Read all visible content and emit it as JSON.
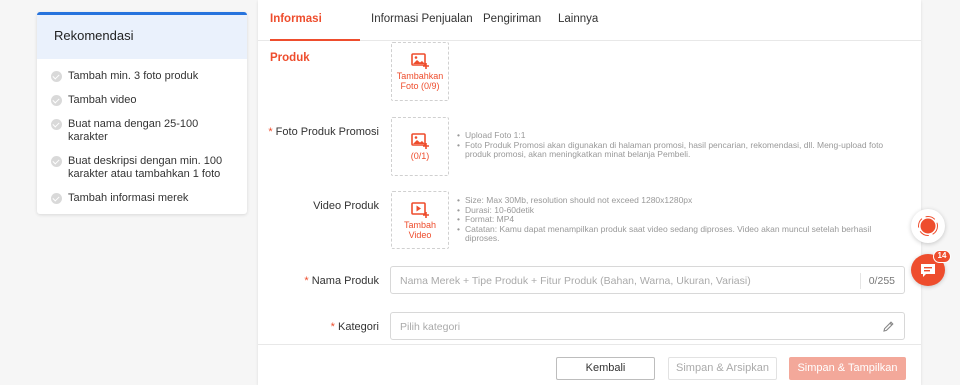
{
  "sidebar": {
    "title": "Rekomendasi",
    "items": [
      {
        "label": "Tambah min. 3 foto produk"
      },
      {
        "label": "Tambah video"
      },
      {
        "label": "Buat nama dengan 25-100 karakter"
      },
      {
        "label": "Buat deskripsi dengan min. 100 karakter atau tambahkan 1 foto"
      },
      {
        "label": "Tambah informasi merek"
      }
    ]
  },
  "tabs": [
    {
      "label": "Informasi Produk",
      "active": true
    },
    {
      "label": "Informasi Penjualan"
    },
    {
      "label": "Pengiriman"
    },
    {
      "label": "Lainnya"
    }
  ],
  "product_photo": {
    "upload_label_1": "Tambahkan",
    "upload_label_2": "Foto (0/9)"
  },
  "promo_photo": {
    "required_mark": "*",
    "label": "Foto Produk Promosi",
    "upload_label": "(0/1)",
    "hints": [
      "Upload Foto 1:1",
      "Foto Produk Promosi akan digunakan di halaman promosi, hasil pencarian, rekomendasi, dll. Meng-upload foto produk promosi, akan meningkatkan minat belanja Pembeli."
    ]
  },
  "video": {
    "label": "Video Produk",
    "upload_label_1": "Tambah",
    "upload_label_2": "Video",
    "hints": [
      "Size: Max 30Mb, resolution should not exceed 1280x1280px",
      "Durasi: 10-60detik",
      "Format: MP4",
      "Catatan: Kamu dapat menampilkan produk saat video sedang diproses. Video akan muncul setelah berhasil diproses."
    ]
  },
  "product_name": {
    "required_mark": "*",
    "label": "Nama Produk",
    "placeholder": "Nama Merek + Tipe Produk + Fitur Produk (Bahan, Warna, Ukuran, Variasi)",
    "counter": "0/255"
  },
  "category": {
    "required_mark": "*",
    "label": "Kategori",
    "placeholder": "Pilih kategori"
  },
  "footer": {
    "back_label": "Kembali",
    "archive_label": "Simpan & Arsipkan",
    "publish_label": "Simpan & Tampilkan"
  },
  "chat": {
    "badge_count": "14"
  },
  "colors": {
    "accent": "#ee4d2d",
    "sidebar_header": "#eaf1fc",
    "sidebar_topline": "#2673dd"
  }
}
